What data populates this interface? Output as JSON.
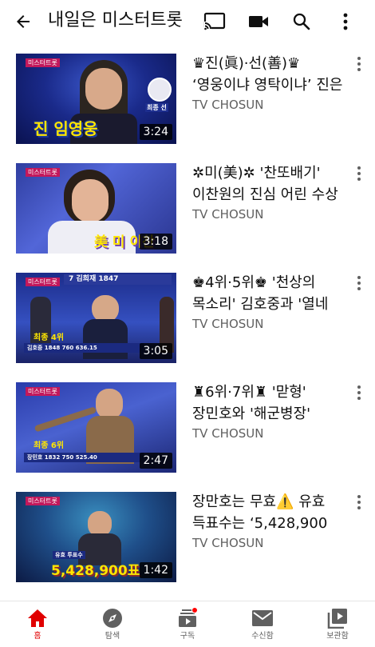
{
  "header": {
    "title": "내일은 미스터트롯"
  },
  "videos": [
    {
      "title_line1": "♛진(眞)·선(善)♛",
      "title_line2": "‘영웅이냐 영탁이냐’ 진은",
      "channel": "TV CHOSUN",
      "duration": "3:24",
      "overlay_text": "진 임영웅",
      "overlay_sub": "최종 선"
    },
    {
      "title_line1": "✲미(美)✲ '찬또배기'",
      "title_line2": "이찬원의 진심 어린 수상",
      "channel": "TV CHOSUN",
      "duration": "3:18",
      "overlay_text": "美 미 이찬",
      "overlay_sub": ""
    },
    {
      "title_line1": "♚4위·5위♚ '천상의",
      "title_line2": "목소리' 김호중과 '열네",
      "channel": "TV CHOSUN",
      "duration": "3:05",
      "overlay_text": "최종 4위",
      "overlay_sub": "김호중  1848  760  636.15",
      "overlay_top": "7   김희재   1847"
    },
    {
      "title_line1": "♜6위·7위♜ '맏형'",
      "title_line2": "장민호와 '해군병장'",
      "channel": "TV CHOSUN",
      "duration": "2:47",
      "overlay_text": "최종 6위",
      "overlay_sub": "장민호  1832  750  525.40"
    },
    {
      "title_line1": "장만호는 무효⚠️ 유효",
      "title_line2": "득표수는 ‘5,428,900",
      "channel": "TV CHOSUN",
      "duration": "1:42",
      "overlay_text": "5,428,900표",
      "overlay_sub": "유효 투표수"
    }
  ],
  "bottom_nav": [
    {
      "label": "홈",
      "icon": "home-icon",
      "active": true
    },
    {
      "label": "탐색",
      "icon": "explore-icon",
      "active": false
    },
    {
      "label": "구독",
      "icon": "subscriptions-icon",
      "active": false
    },
    {
      "label": "수신함",
      "icon": "inbox-icon",
      "active": false
    },
    {
      "label": "보관함",
      "icon": "library-icon",
      "active": false
    }
  ],
  "colors": {
    "accent": "#ff0000",
    "text_primary": "#0f0f0f",
    "text_secondary": "#606060"
  }
}
